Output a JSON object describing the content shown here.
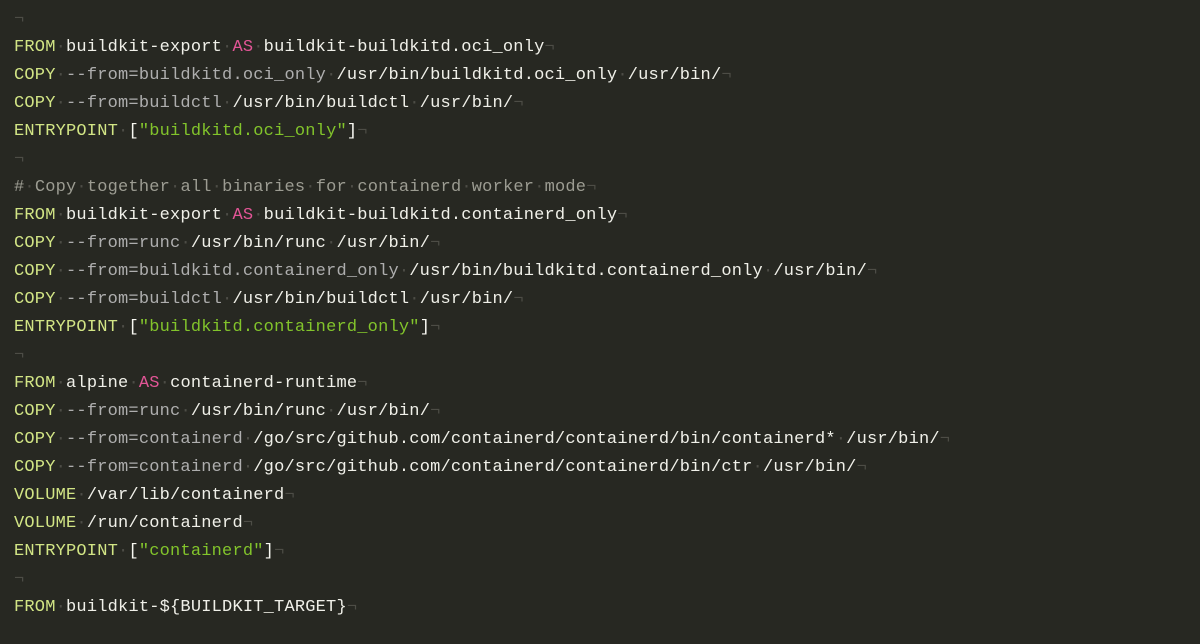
{
  "editor": {
    "whitespace": {
      "space": "·",
      "nl": "¬"
    },
    "lines": [
      [
        [
          "ws",
          "¬"
        ]
      ],
      [
        [
          "kw",
          "FROM"
        ],
        [
          "ws",
          "·"
        ],
        [
          "plain",
          "buildkit-export"
        ],
        [
          "ws",
          "·"
        ],
        [
          "op",
          "AS"
        ],
        [
          "ws",
          "·"
        ],
        [
          "plain",
          "buildkit-buildkitd.oci_only"
        ],
        [
          "ws",
          "¬"
        ]
      ],
      [
        [
          "kw",
          "COPY"
        ],
        [
          "ws",
          "·"
        ],
        [
          "flag",
          "--from=buildkitd.oci_only"
        ],
        [
          "ws",
          "·"
        ],
        [
          "plain",
          "/usr/bin/buildkitd.oci_only"
        ],
        [
          "ws",
          "·"
        ],
        [
          "plain",
          "/usr/bin/"
        ],
        [
          "ws",
          "¬"
        ]
      ],
      [
        [
          "kw",
          "COPY"
        ],
        [
          "ws",
          "·"
        ],
        [
          "flag",
          "--from=buildctl"
        ],
        [
          "ws",
          "·"
        ],
        [
          "plain",
          "/usr/bin/buildctl"
        ],
        [
          "ws",
          "·"
        ],
        [
          "plain",
          "/usr/bin/"
        ],
        [
          "ws",
          "¬"
        ]
      ],
      [
        [
          "kw",
          "ENTRYPOINT"
        ],
        [
          "ws",
          "·"
        ],
        [
          "punc",
          "["
        ],
        [
          "str",
          "\"buildkitd.oci_only\""
        ],
        [
          "punc",
          "]"
        ],
        [
          "ws",
          "¬"
        ]
      ],
      [
        [
          "ws",
          "¬"
        ]
      ],
      [
        [
          "comm",
          "#"
        ],
        [
          "ws",
          "·"
        ],
        [
          "comm",
          "Copy"
        ],
        [
          "ws",
          "·"
        ],
        [
          "comm",
          "together"
        ],
        [
          "ws",
          "·"
        ],
        [
          "comm",
          "all"
        ],
        [
          "ws",
          "·"
        ],
        [
          "comm",
          "binaries"
        ],
        [
          "ws",
          "·"
        ],
        [
          "comm",
          "for"
        ],
        [
          "ws",
          "·"
        ],
        [
          "comm",
          "containerd"
        ],
        [
          "ws",
          "·"
        ],
        [
          "comm",
          "worker"
        ],
        [
          "ws",
          "·"
        ],
        [
          "comm",
          "mode"
        ],
        [
          "ws",
          "¬"
        ]
      ],
      [
        [
          "kw",
          "FROM"
        ],
        [
          "ws",
          "·"
        ],
        [
          "plain",
          "buildkit-export"
        ],
        [
          "ws",
          "·"
        ],
        [
          "op",
          "AS"
        ],
        [
          "ws",
          "·"
        ],
        [
          "plain",
          "buildkit-buildkitd.containerd_only"
        ],
        [
          "ws",
          "¬"
        ]
      ],
      [
        [
          "kw",
          "COPY"
        ],
        [
          "ws",
          "·"
        ],
        [
          "flag",
          "--from=runc"
        ],
        [
          "ws",
          "·"
        ],
        [
          "plain",
          "/usr/bin/runc"
        ],
        [
          "ws",
          "·"
        ],
        [
          "plain",
          "/usr/bin/"
        ],
        [
          "ws",
          "¬"
        ]
      ],
      [
        [
          "kw",
          "COPY"
        ],
        [
          "ws",
          "·"
        ],
        [
          "flag",
          "--from=buildkitd.containerd_only"
        ],
        [
          "ws",
          "·"
        ],
        [
          "plain",
          "/usr/bin/buildkitd.containerd_only"
        ],
        [
          "ws",
          "·"
        ],
        [
          "plain",
          "/usr/bin/"
        ],
        [
          "ws",
          "¬"
        ]
      ],
      [
        [
          "kw",
          "COPY"
        ],
        [
          "ws",
          "·"
        ],
        [
          "flag",
          "--from=buildctl"
        ],
        [
          "ws",
          "·"
        ],
        [
          "plain",
          "/usr/bin/buildctl"
        ],
        [
          "ws",
          "·"
        ],
        [
          "plain",
          "/usr/bin/"
        ],
        [
          "ws",
          "¬"
        ]
      ],
      [
        [
          "kw",
          "ENTRYPOINT"
        ],
        [
          "ws",
          "·"
        ],
        [
          "punc",
          "["
        ],
        [
          "str",
          "\"buildkitd.containerd_only\""
        ],
        [
          "punc",
          "]"
        ],
        [
          "ws",
          "¬"
        ]
      ],
      [
        [
          "ws",
          "¬"
        ]
      ],
      [
        [
          "kw",
          "FROM"
        ],
        [
          "ws",
          "·"
        ],
        [
          "plain",
          "alpine"
        ],
        [
          "ws",
          "·"
        ],
        [
          "op",
          "AS"
        ],
        [
          "ws",
          "·"
        ],
        [
          "plain",
          "containerd-runtime"
        ],
        [
          "ws",
          "¬"
        ]
      ],
      [
        [
          "kw",
          "COPY"
        ],
        [
          "ws",
          "·"
        ],
        [
          "flag",
          "--from=runc"
        ],
        [
          "ws",
          "·"
        ],
        [
          "plain",
          "/usr/bin/runc"
        ],
        [
          "ws",
          "·"
        ],
        [
          "plain",
          "/usr/bin/"
        ],
        [
          "ws",
          "¬"
        ]
      ],
      [
        [
          "kw",
          "COPY"
        ],
        [
          "ws",
          "·"
        ],
        [
          "flag",
          "--from=containerd"
        ],
        [
          "ws",
          "·"
        ],
        [
          "plain",
          "/go/src/github.com/containerd/containerd/bin/containerd*"
        ],
        [
          "ws",
          "·"
        ],
        [
          "plain",
          "/usr/bin/"
        ],
        [
          "ws",
          "¬"
        ]
      ],
      [
        [
          "kw",
          "COPY"
        ],
        [
          "ws",
          "·"
        ],
        [
          "flag",
          "--from=containerd"
        ],
        [
          "ws",
          "·"
        ],
        [
          "plain",
          "/go/src/github.com/containerd/containerd/bin/ctr"
        ],
        [
          "ws",
          "·"
        ],
        [
          "plain",
          "/usr/bin/"
        ],
        [
          "ws",
          "¬"
        ]
      ],
      [
        [
          "kw",
          "VOLUME"
        ],
        [
          "ws",
          "·"
        ],
        [
          "plain",
          "/var/lib/containerd"
        ],
        [
          "ws",
          "¬"
        ]
      ],
      [
        [
          "kw",
          "VOLUME"
        ],
        [
          "ws",
          "·"
        ],
        [
          "plain",
          "/run/containerd"
        ],
        [
          "ws",
          "¬"
        ]
      ],
      [
        [
          "kw",
          "ENTRYPOINT"
        ],
        [
          "ws",
          "·"
        ],
        [
          "punc",
          "["
        ],
        [
          "str",
          "\"containerd\""
        ],
        [
          "punc",
          "]"
        ],
        [
          "ws",
          "¬"
        ]
      ],
      [
        [
          "ws",
          "¬"
        ]
      ],
      [
        [
          "kw",
          "FROM"
        ],
        [
          "ws",
          "·"
        ],
        [
          "plain",
          "buildkit-${BUILDKIT_TARGET}"
        ],
        [
          "ws",
          "¬"
        ]
      ]
    ]
  }
}
